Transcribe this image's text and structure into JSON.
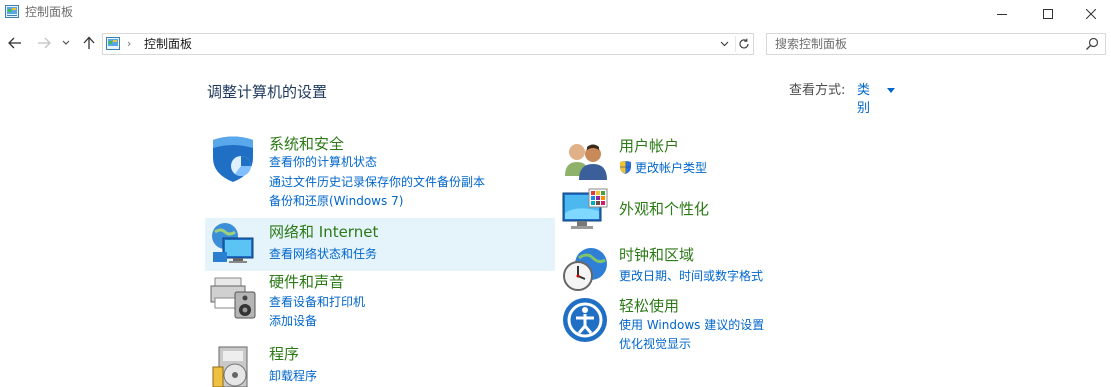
{
  "window": {
    "title": "控制面板"
  },
  "address": {
    "crumb": "控制面板",
    "separator": "›"
  },
  "search": {
    "placeholder": "搜索控制面板"
  },
  "main": {
    "heading": "调整计算机的设置",
    "view_by_label": "查看方式:",
    "view_by_value": "类别"
  },
  "categories_left": [
    {
      "title": "系统和安全",
      "icon": "shield-icon",
      "links": [
        "查看你的计算机状态",
        "通过文件历史记录保存你的文件备份副本",
        "备份和还原(Windows 7)"
      ]
    },
    {
      "title": "网络和 Internet",
      "icon": "network-globe-icon",
      "links": [
        "查看网络状态和任务"
      ]
    },
    {
      "title": "硬件和声音",
      "icon": "printer-speaker-icon",
      "links": [
        "查看设备和打印机",
        "添加设备"
      ]
    },
    {
      "title": "程序",
      "icon": "programs-disc-icon",
      "links": [
        "卸载程序"
      ]
    }
  ],
  "categories_right": [
    {
      "title": "用户帐户",
      "icon": "users-icon",
      "links": [
        "更改帐户类型"
      ]
    },
    {
      "title": "外观和个性化",
      "icon": "monitor-palette-icon",
      "links": []
    },
    {
      "title": "时钟和区域",
      "icon": "clock-globe-icon",
      "links": [
        "更改日期、时间或数字格式"
      ]
    },
    {
      "title": "轻松使用",
      "icon": "ease-of-access-icon",
      "links": [
        "使用 Windows 建议的设置",
        "优化视觉显示"
      ]
    }
  ],
  "colors": {
    "link": "#0066cc",
    "category_title": "#2b7a16",
    "heading": "#1e395b",
    "hover": "#e5f3fb"
  }
}
